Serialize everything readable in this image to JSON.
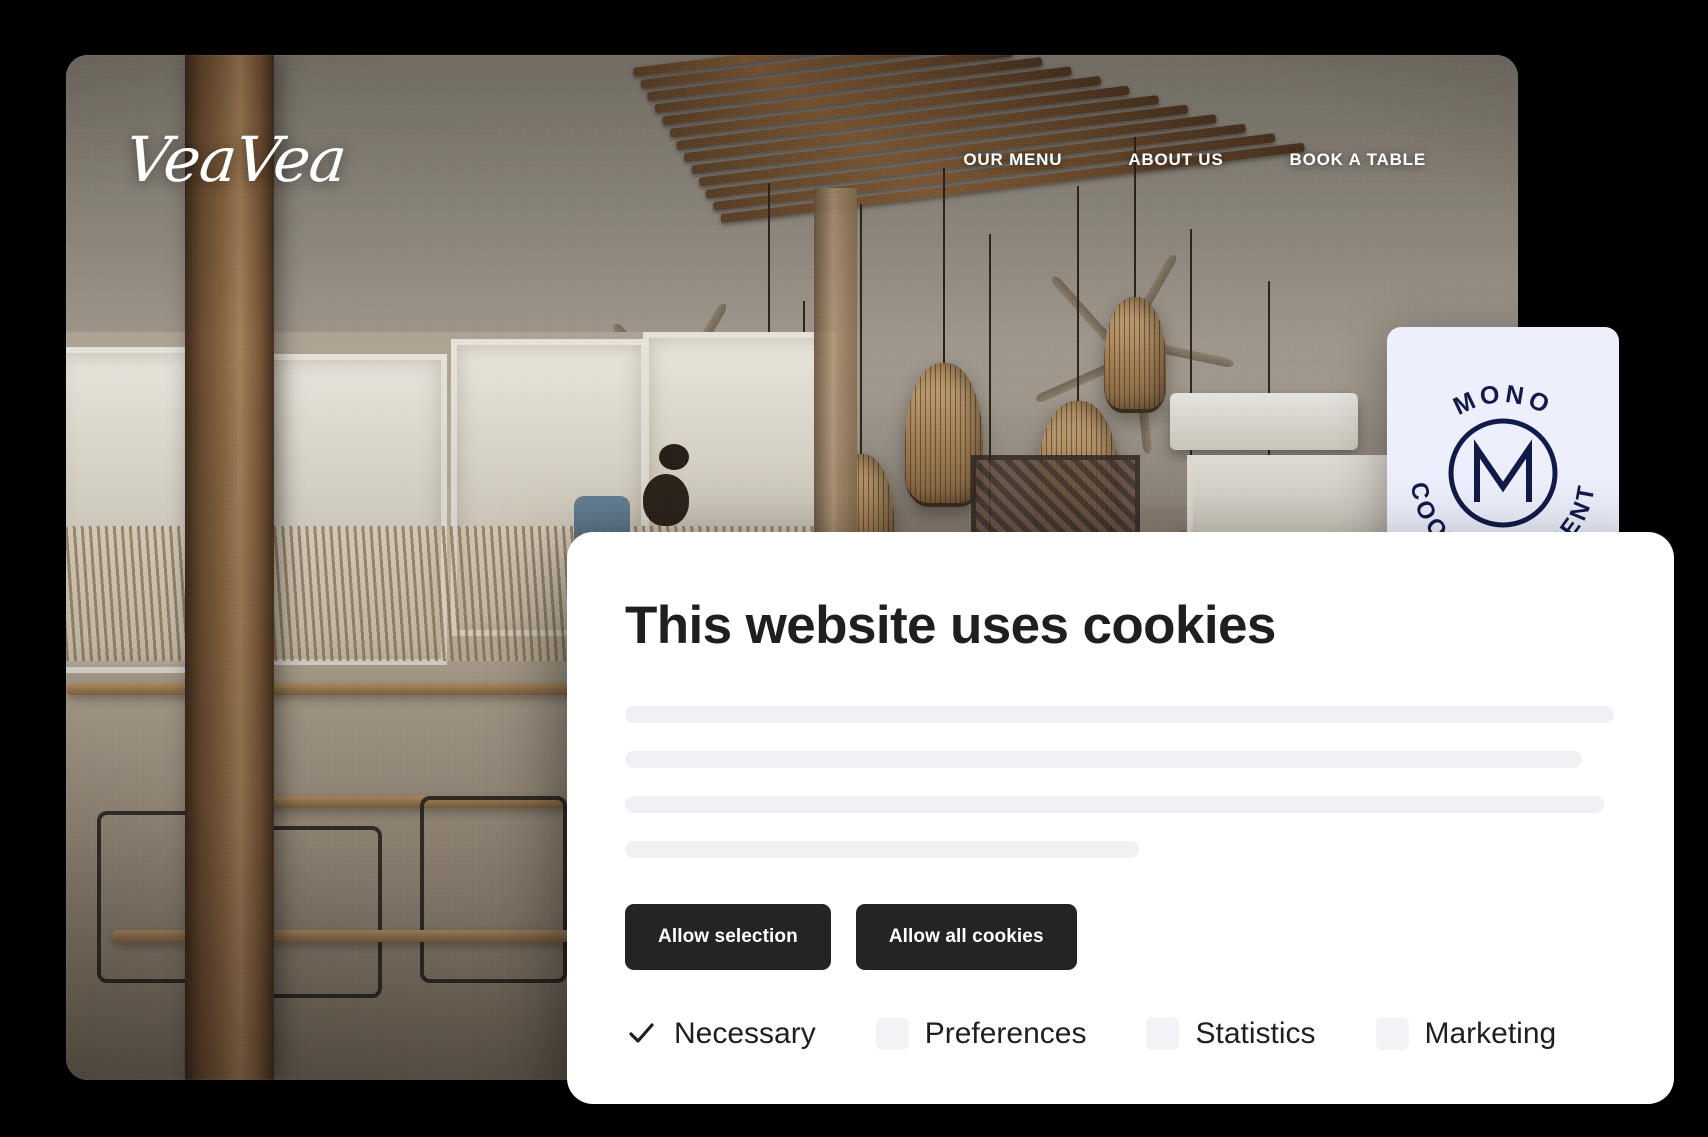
{
  "site": {
    "brand": "VeaVea",
    "nav": [
      {
        "label": "OUR MENU"
      },
      {
        "label": "ABOUT US"
      },
      {
        "label": "BOOK A TABLE"
      }
    ]
  },
  "badge": {
    "top_text": "MONO",
    "bottom_text": "COOKIE CONSENT",
    "monogram": "M",
    "bg_color": "#edf0fc",
    "ink_color": "#121a4a"
  },
  "cookie_dialog": {
    "title": "This website uses cookies",
    "body_placeholder_lines": 4,
    "buttons": [
      {
        "label": "Allow selection"
      },
      {
        "label": "Allow all cookies"
      }
    ],
    "categories": [
      {
        "label": "Necessary",
        "checked": true
      },
      {
        "label": "Preferences",
        "checked": false
      },
      {
        "label": "Statistics",
        "checked": false
      },
      {
        "label": "Marketing",
        "checked": false
      }
    ],
    "button_color": "#242424",
    "placeholder_color": "#f0f1f5",
    "checkbox_color": "#f2f3f7"
  }
}
